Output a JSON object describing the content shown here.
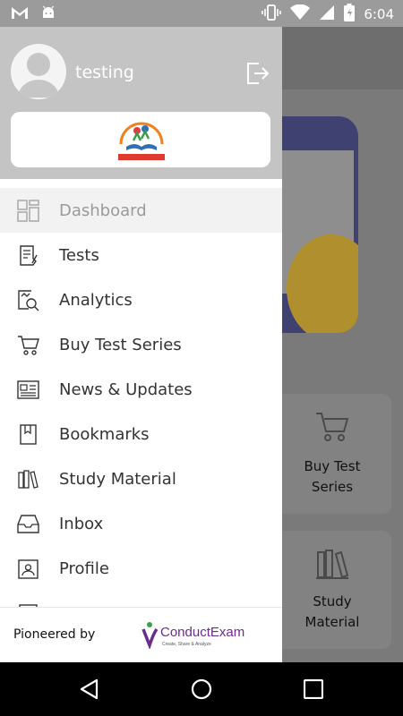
{
  "status_bar": {
    "time": "6:04",
    "left_icons": [
      "gmail-icon",
      "android-icon"
    ],
    "right_icons": [
      "vibrate-icon",
      "wifi-icon",
      "signal-icon",
      "battery-icon"
    ]
  },
  "drawer": {
    "user_name": "testing",
    "menu": [
      {
        "label": "Dashboard",
        "icon": "dashboard-icon",
        "active": true
      },
      {
        "label": "Tests",
        "icon": "tests-icon",
        "active": false
      },
      {
        "label": "Analytics",
        "icon": "analytics-icon",
        "active": false
      },
      {
        "label": "Buy Test Series",
        "icon": "cart-icon",
        "active": false
      },
      {
        "label": "News & Updates",
        "icon": "news-icon",
        "active": false
      },
      {
        "label": "Bookmarks",
        "icon": "bookmark-icon",
        "active": false
      },
      {
        "label": "Study Material",
        "icon": "books-icon",
        "active": false
      },
      {
        "label": "Inbox",
        "icon": "inbox-icon",
        "active": false
      },
      {
        "label": "Profile",
        "icon": "profile-icon",
        "active": false
      }
    ],
    "footer": {
      "pioneered_label": "Pioneered by",
      "brand_name": "ConductExam",
      "brand_tagline": "Create, Share & Analyze"
    }
  },
  "background": {
    "cards": [
      {
        "label_line1": "Buy Test",
        "label_line2": "Series",
        "icon": "cart-icon"
      },
      {
        "label_line1": "Study",
        "label_line2": "Material",
        "icon": "books-icon"
      }
    ]
  },
  "colors": {
    "header_gray": "#c4c4c4",
    "active_item_bg": "#f2f2f2",
    "brand_purple": "#6a2c8e",
    "logo_orange": "#f0821e"
  }
}
